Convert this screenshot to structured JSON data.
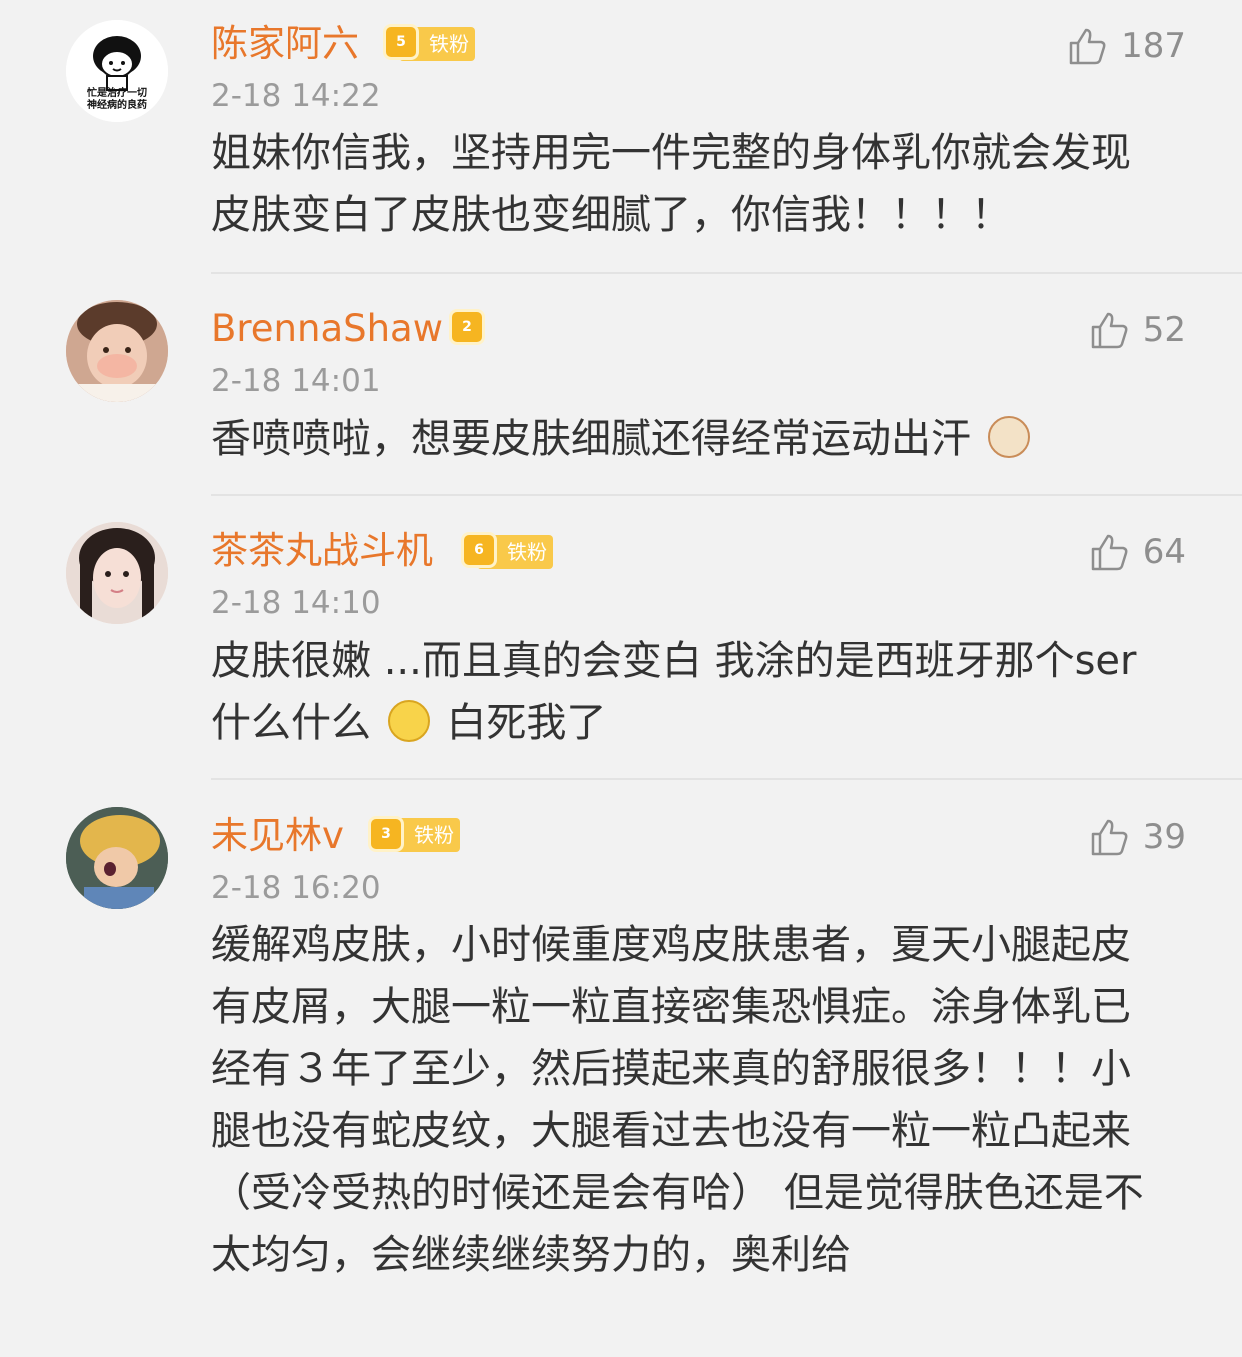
{
  "comments": [
    {
      "username": "陈家阿六",
      "badge_level": "5",
      "badge_label": "铁粉",
      "timestamp": "2-18 14:22",
      "likes": "187",
      "avatar_caption_1": "忙是治疗一切",
      "avatar_caption_2": "神经病的良药",
      "text": "姐妹你信我，坚持用完一件完整的身体乳你就会发现皮肤变白了皮肤也变细腻了，你信我！！！！"
    },
    {
      "username": "BrennaShaw",
      "badge_level": "2",
      "timestamp": "2-18 14:01",
      "likes": "52",
      "text": "香喷喷啦，想要皮肤细腻还得经常运动出汗"
    },
    {
      "username": "茶茶丸战斗机",
      "badge_level": "6",
      "badge_label": "铁粉",
      "timestamp": "2-18 14:10",
      "likes": "64",
      "text_before": "皮肤很嫩 ...而且真的会变白 我涂的是西班牙那个ser什么什么 ",
      "text_after": "白死我了"
    },
    {
      "username": "未见林v",
      "badge_level": "3",
      "badge_label": "铁粉",
      "timestamp": "2-18 16:20",
      "likes": "39",
      "text": "缓解鸡皮肤，小时候重度鸡皮肤患者，夏天小腿起皮有皮屑，大腿一粒一粒直接密集恐惧症。涂身体乳已经有３年了至少，然后摸起来真的舒服很多！！！小腿也没有蛇皮纹，大腿看过去也没有一粒一粒凸起来（受冷受热的时候还是会有哈） 但是觉得肤色还是不太均匀，会继续继续努力的，奥利给"
    }
  ],
  "colors": {
    "username": "#e8772b",
    "timestamp": "#9b9b9b",
    "body": "#333333",
    "background": "#f2f2f2",
    "badge": "#f6b521"
  },
  "icons": [
    "thumbs-up-icon",
    "crown-badge-icon",
    "cow-emoji-icon",
    "dizzy-face-emoji-icon"
  ]
}
